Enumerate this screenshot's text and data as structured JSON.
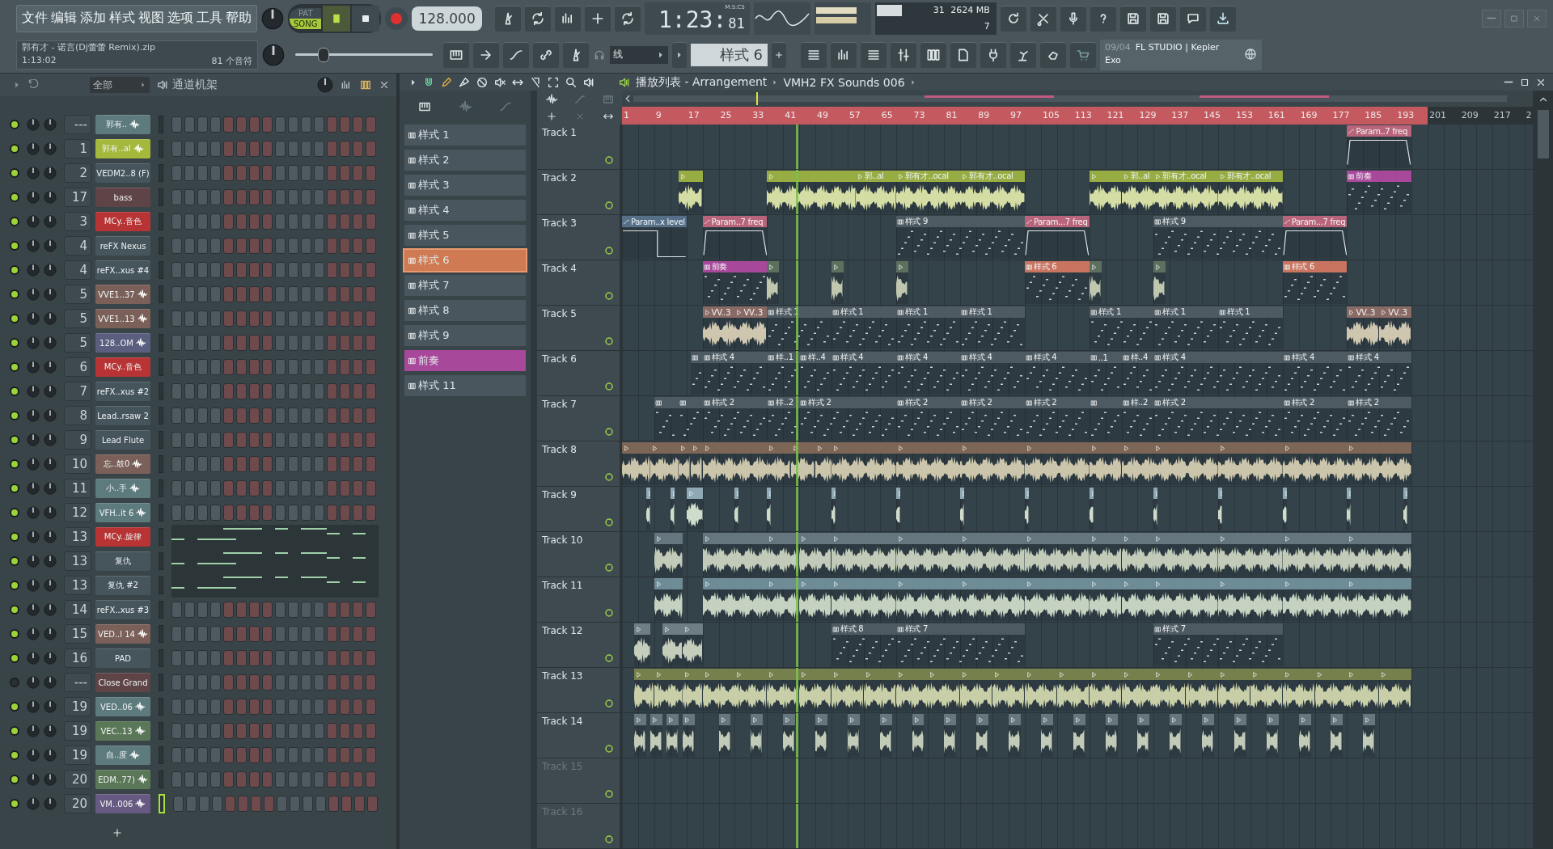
{
  "menu": [
    "文件",
    "编辑",
    "添加",
    "样式",
    "视图",
    "选项",
    "工具",
    "帮助"
  ],
  "song": {
    "title": "郭有才 - 诺言(Dj蕾蕾 Remix).zip",
    "time": "1:13:02",
    "notes": "81 个音符"
  },
  "transport": {
    "modes": [
      {
        "label": "PAT",
        "selected": false
      },
      {
        "label": "SONG",
        "selected": true
      }
    ],
    "tempo": "128.000"
  },
  "time_display": {
    "unit": "M:S:CS",
    "value": "1:23:",
    "centiseconds": "81"
  },
  "cpu": {
    "level": 0.35,
    "voices": "31",
    "memory": "2624 MB",
    "polyphony": "7"
  },
  "master_volume": {
    "level": 0.2
  },
  "snap": {
    "value": "线"
  },
  "pattern_selector": {
    "value": "样式 6"
  },
  "hint": {
    "date": "09/04",
    "title": "FL STUDIO | Kepler",
    "subtitle": "Exo"
  },
  "channel_rack": {
    "filter": "全部",
    "title": "通道机架",
    "channels": [
      {
        "number": "---",
        "name": "郭有..",
        "kind": "sample",
        "color": "#5d7a7c",
        "on": true,
        "selected": false
      },
      {
        "number": "1",
        "name": "郭有..al",
        "kind": "sample",
        "color": "#a4b83c",
        "on": true,
        "selected": false
      },
      {
        "number": "2",
        "name": "VEDM2..8 (F)",
        "kind": "plugin",
        "color": "#46555c",
        "on": true,
        "selected": false
      },
      {
        "number": "17",
        "name": "bass",
        "kind": "plugin",
        "color": "#5e4446",
        "on": true,
        "selected": false
      },
      {
        "number": "3",
        "name": "MCy..音色",
        "kind": "plugin",
        "color": "#b83434",
        "on": true,
        "selected": false
      },
      {
        "number": "4",
        "name": "reFX Nexus",
        "kind": "plugin",
        "color": "#46555c",
        "on": true,
        "selected": false
      },
      {
        "number": "4",
        "name": "reFX..xus #4",
        "kind": "plugin",
        "color": "#46555c",
        "on": true,
        "selected": false
      },
      {
        "number": "5",
        "name": "VVE1..37",
        "kind": "sample",
        "color": "#7a6058",
        "on": true,
        "selected": false
      },
      {
        "number": "5",
        "name": "VVE1..13",
        "kind": "sample",
        "color": "#7a6058",
        "on": true,
        "selected": false
      },
      {
        "number": "5",
        "name": "128..OM",
        "kind": "sample",
        "color": "#5a5f80",
        "on": true,
        "selected": false
      },
      {
        "number": "6",
        "name": "MCy..音色",
        "kind": "plugin",
        "color": "#b83434",
        "on": true,
        "selected": false
      },
      {
        "number": "7",
        "name": "reFX..xus #2",
        "kind": "plugin",
        "color": "#46555c",
        "on": true,
        "selected": false
      },
      {
        "number": "8",
        "name": "Lead..rsaw 2",
        "kind": "plugin",
        "color": "#46555c",
        "on": true,
        "selected": false
      },
      {
        "number": "9",
        "name": "Lead Flute",
        "kind": "plugin",
        "color": "#46555c",
        "on": true,
        "selected": false
      },
      {
        "number": "10",
        "name": "忘..鼓0",
        "kind": "sample",
        "color": "#7a6058",
        "on": true,
        "selected": false
      },
      {
        "number": "11",
        "name": "小..手",
        "kind": "sample",
        "color": "#5d7a7c",
        "on": true,
        "selected": false
      },
      {
        "number": "12",
        "name": "VFH..it 6",
        "kind": "sample",
        "color": "#5d7a7c",
        "on": true,
        "selected": false
      },
      {
        "number": "13",
        "name": "MCy..旋律",
        "kind": "plugin",
        "color": "#b83434",
        "on": true,
        "selected": false,
        "piano_roll": true
      },
      {
        "number": "13",
        "name": "复仇",
        "kind": "plugin",
        "color": "#46555c",
        "on": true,
        "selected": false,
        "piano_roll": true
      },
      {
        "number": "13",
        "name": "复仇 #2",
        "kind": "plugin",
        "color": "#46555c",
        "on": true,
        "selected": false,
        "piano_roll": true
      },
      {
        "number": "14",
        "name": "reFX..xus #3",
        "kind": "plugin",
        "color": "#46555c",
        "on": true,
        "selected": false
      },
      {
        "number": "15",
        "name": "VED..l 14",
        "kind": "sample",
        "color": "#7a6058",
        "on": true,
        "selected": false
      },
      {
        "number": "16",
        "name": "PAD",
        "kind": "plugin",
        "color": "#46555c",
        "on": true,
        "selected": false
      },
      {
        "number": "---",
        "name": "Close Grand",
        "kind": "plugin",
        "color": "#5e4446",
        "on": false,
        "selected": false
      },
      {
        "number": "19",
        "name": "VED..06",
        "kind": "sample",
        "color": "#5d7a7c",
        "on": true,
        "selected": false
      },
      {
        "number": "19",
        "name": "VEC..13",
        "kind": "sample",
        "color": "#5a7858",
        "on": true,
        "selected": false
      },
      {
        "number": "19",
        "name": "自..度",
        "kind": "sample",
        "color": "#5d7a7c",
        "on": true,
        "selected": false
      },
      {
        "number": "20",
        "name": "EDM..77)",
        "kind": "sample",
        "color": "#5a7858",
        "on": true,
        "selected": false
      },
      {
        "number": "20",
        "name": "VM..006",
        "kind": "sample",
        "color": "#675a82",
        "on": true,
        "selected": true
      }
    ]
  },
  "patterns": [
    {
      "name": "样式 1",
      "color": "#4a565d",
      "selected": false
    },
    {
      "name": "样式 2",
      "color": "#4a565d",
      "selected": false
    },
    {
      "name": "样式 3",
      "color": "#4a565d",
      "selected": false
    },
    {
      "name": "样式 4",
      "color": "#4a565d",
      "selected": false
    },
    {
      "name": "样式 5",
      "color": "#4a565d",
      "selected": false
    },
    {
      "name": "样式 6",
      "color": "#cf7a52",
      "selected": true
    },
    {
      "name": "样式 7",
      "color": "#4a565d",
      "selected": false
    },
    {
      "name": "样式 8",
      "color": "#4a565d",
      "selected": false
    },
    {
      "name": "样式 9",
      "color": "#4a565d",
      "selected": false
    },
    {
      "name": "前奏",
      "color": "#a8489a",
      "selected": false
    },
    {
      "name": "样式 11",
      "color": "#4a565d",
      "selected": false
    }
  ],
  "playlist": {
    "title": "播放列表 - Arrangement",
    "current": "VMH2 FX Sounds 006",
    "playhead": {
      "level": 0.191
    },
    "ruler": [
      {
        "label": "1",
        "in_song": true
      },
      {
        "label": "9",
        "in_song": true
      },
      {
        "label": "17",
        "in_song": true
      },
      {
        "label": "25",
        "in_song": true
      },
      {
        "label": "33",
        "in_song": true
      },
      {
        "label": "41",
        "in_song": true
      },
      {
        "label": "49",
        "in_song": true
      },
      {
        "label": "57",
        "in_song": true
      },
      {
        "label": "65",
        "in_song": true
      },
      {
        "label": "73",
        "in_song": true
      },
      {
        "label": "81",
        "in_song": true
      },
      {
        "label": "89",
        "in_song": true
      },
      {
        "label": "97",
        "in_song": true
      },
      {
        "label": "105",
        "in_song": true
      },
      {
        "label": "113",
        "in_song": true
      },
      {
        "label": "121",
        "in_song": true
      },
      {
        "label": "129",
        "in_song": true
      },
      {
        "label": "137",
        "in_song": true
      },
      {
        "label": "145",
        "in_song": true
      },
      {
        "label": "153",
        "in_song": true
      },
      {
        "label": "161",
        "in_song": true
      },
      {
        "label": "169",
        "in_song": true
      },
      {
        "label": "177",
        "in_song": true
      },
      {
        "label": "185",
        "in_song": true
      },
      {
        "label": "193",
        "in_song": true
      },
      {
        "label": "201",
        "in_song": false
      },
      {
        "label": "209",
        "in_song": false
      },
      {
        "label": "217",
        "in_song": false
      },
      {
        "label": "2",
        "in_song": false
      }
    ],
    "tracks": [
      {
        "name": "Track 1",
        "dimmed": false,
        "clips": [
          {
            "kind": "automation",
            "label": "Param..7 freq",
            "color": "#b8647a"
          }
        ]
      },
      {
        "name": "Track 2",
        "dimmed": false,
        "clips": [
          {
            "kind": "audio",
            "color": "#98ac44"
          },
          {
            "kind": "audio",
            "color": "#98ac44"
          },
          {
            "kind": "audio",
            "label": "郭..al",
            "color": "#98ac44"
          },
          {
            "kind": "audio",
            "label": "郭有才..ocal",
            "color": "#98ac44"
          },
          {
            "kind": "audio",
            "label": "郭有才..ocal",
            "color": "#98ac44"
          },
          {
            "kind": "audio",
            "color": "#98ac44"
          },
          {
            "kind": "audio",
            "label": "郭..al",
            "color": "#98ac44"
          },
          {
            "kind": "audio",
            "label": "郭有才..ocal",
            "color": "#98ac44"
          },
          {
            "kind": "audio",
            "label": "郭有才..ocal",
            "color": "#98ac44"
          },
          {
            "kind": "pattern",
            "label": "前奏",
            "color": "#a8489a"
          }
        ]
      },
      {
        "name": "Track 3",
        "dimmed": false,
        "clips": [
          {
            "kind": "automation",
            "label": "Param..x level",
            "color": "#56708a"
          },
          {
            "kind": "automation",
            "label": "Param..7 freq",
            "color": "#b8647a"
          },
          {
            "kind": "pattern",
            "label": "样式 9",
            "color": "#4e5a61"
          },
          {
            "kind": "automation",
            "label": "Param...7 freq",
            "color": "#b8647a"
          },
          {
            "kind": "pattern",
            "label": "样式 9",
            "color": "#4e5a61"
          },
          {
            "kind": "automation",
            "label": "Param...7 freq",
            "color": "#b8647a"
          }
        ]
      },
      {
        "name": "Track 4",
        "dimmed": false,
        "clips": [
          {
            "kind": "pattern",
            "label": "前奏",
            "color": "#a8489a"
          },
          {
            "kind": "audio",
            "color": "#5d7060"
          },
          {
            "kind": "audio",
            "color": "#5d7060"
          },
          {
            "kind": "audio",
            "color": "#5d7060"
          },
          {
            "kind": "pattern",
            "label": "样式 6",
            "color": "#c87460"
          },
          {
            "kind": "audio",
            "color": "#5d7060"
          },
          {
            "kind": "audio",
            "color": "#5d7060"
          },
          {
            "kind": "pattern",
            "label": "样式 6",
            "color": "#c87460"
          }
        ]
      },
      {
        "name": "Track 5",
        "dimmed": false,
        "clips": [
          {
            "kind": "audio",
            "label": "VV..3",
            "color": "#8a6a64"
          },
          {
            "kind": "audio",
            "label": "VV..3",
            "color": "#8a6a64"
          },
          {
            "kind": "pattern",
            "label": "样式 1",
            "color": "#4e5a61"
          },
          {
            "kind": "pattern",
            "label": "样式 1",
            "color": "#4e5a61"
          },
          {
            "kind": "pattern",
            "label": "样式 1",
            "color": "#4e5a61"
          },
          {
            "kind": "pattern",
            "label": "样式 1",
            "color": "#4e5a61"
          },
          {
            "kind": "pattern",
            "label": "样式 1",
            "color": "#4e5a61"
          },
          {
            "kind": "pattern",
            "label": "样式 1",
            "color": "#4e5a61"
          },
          {
            "kind": "pattern",
            "label": "样式 1",
            "color": "#4e5a61"
          },
          {
            "kind": "audio",
            "label": "VV..3",
            "color": "#8a6a64"
          },
          {
            "kind": "audio",
            "label": "VV..3",
            "color": "#8a6a64"
          }
        ]
      },
      {
        "name": "Track 6",
        "dimmed": false,
        "clips": [
          {
            "kind": "pattern",
            "color": "#4e5a61"
          },
          {
            "kind": "pattern",
            "label": "样式 4",
            "color": "#4e5a61"
          },
          {
            "kind": "pattern",
            "label": "样..1",
            "color": "#4e5a61"
          },
          {
            "kind": "pattern",
            "label": "样..4",
            "color": "#4e5a61"
          },
          {
            "kind": "pattern",
            "label": "样式 4",
            "color": "#4e5a61"
          },
          {
            "kind": "pattern",
            "label": "样式 4",
            "color": "#4e5a61"
          },
          {
            "kind": "pattern",
            "label": "样式 4",
            "color": "#4e5a61"
          },
          {
            "kind": "pattern",
            "label": "样式 4",
            "color": "#4e5a61"
          },
          {
            "kind": "pattern",
            "label": "..1",
            "color": "#4e5a61"
          },
          {
            "kind": "pattern",
            "label": "样..4",
            "color": "#4e5a61"
          },
          {
            "kind": "pattern",
            "label": "样式 4",
            "color": "#4e5a61"
          },
          {
            "kind": "pattern",
            "label": "样式 4",
            "color": "#4e5a61"
          },
          {
            "kind": "pattern",
            "label": "样式 4",
            "color": "#4e5a61"
          }
        ]
      },
      {
        "name": "Track 7",
        "dimmed": false,
        "clips": [
          {
            "kind": "pattern",
            "color": "#4e5a61"
          },
          {
            "kind": "pattern",
            "color": "#4e5a61"
          },
          {
            "kind": "pattern",
            "label": "样式 2",
            "color": "#4e5a61"
          },
          {
            "kind": "pattern",
            "label": "样..2",
            "color": "#4e5a61"
          },
          {
            "kind": "pattern",
            "label": "样式 2",
            "color": "#4e5a61"
          },
          {
            "kind": "pattern",
            "label": "样式 2",
            "color": "#4e5a61"
          },
          {
            "kind": "pattern",
            "label": "样式 2",
            "color": "#4e5a61"
          },
          {
            "kind": "pattern",
            "label": "样式 2",
            "color": "#4e5a61"
          },
          {
            "kind": "pattern",
            "color": "#4e5a61"
          },
          {
            "kind": "pattern",
            "label": "样..2",
            "color": "#4e5a61"
          },
          {
            "kind": "pattern",
            "label": "样式 2",
            "color": "#4e5a61"
          },
          {
            "kind": "pattern",
            "label": "样式 2",
            "color": "#4e5a61"
          },
          {
            "kind": "pattern",
            "label": "样式 2",
            "color": "#4e5a61"
          }
        ]
      },
      {
        "name": "Track 8",
        "dimmed": false,
        "clips": [
          {
            "kind": "audio",
            "color": "#7e6656"
          },
          {
            "kind": "audio",
            "color": "#7e6656"
          },
          {
            "kind": "audio",
            "color": "#7e6656"
          },
          {
            "kind": "audio",
            "color": "#7e6656"
          },
          {
            "kind": "audio",
            "color": "#7e6656"
          },
          {
            "kind": "audio",
            "color": "#7e6656"
          },
          {
            "kind": "audio",
            "color": "#7e6656"
          },
          {
            "kind": "audio",
            "color": "#7e6656"
          },
          {
            "kind": "audio",
            "color": "#7e6656"
          },
          {
            "kind": "audio",
            "color": "#7e6656"
          },
          {
            "kind": "audio",
            "color": "#7e6656"
          },
          {
            "kind": "audio",
            "color": "#7e6656"
          },
          {
            "kind": "audio",
            "color": "#7e6656"
          },
          {
            "kind": "audio",
            "color": "#7e6656"
          },
          {
            "kind": "audio",
            "color": "#7e6656"
          },
          {
            "kind": "audio",
            "color": "#7e6656"
          },
          {
            "kind": "audio",
            "color": "#7e6656"
          },
          {
            "kind": "audio",
            "color": "#7e6656"
          }
        ]
      },
      {
        "name": "Track 9",
        "dimmed": false,
        "clips": [
          {
            "kind": "audio",
            "color": "#8ea8b4"
          },
          {
            "kind": "audio",
            "color": "#8ea8b4"
          },
          {
            "kind": "audio",
            "color": "#8ea8b4"
          },
          {
            "kind": "audio",
            "color": "#8ea8b4"
          },
          {
            "kind": "audio",
            "color": "#8ea8b4"
          },
          {
            "kind": "audio",
            "color": "#8ea8b4"
          },
          {
            "kind": "audio",
            "color": "#8ea8b4"
          },
          {
            "kind": "audio",
            "color": "#8ea8b4"
          },
          {
            "kind": "audio",
            "color": "#8ea8b4"
          },
          {
            "kind": "audio",
            "color": "#8ea8b4"
          },
          {
            "kind": "audio",
            "color": "#8ea8b4"
          },
          {
            "kind": "audio",
            "color": "#8ea8b4"
          },
          {
            "kind": "audio",
            "color": "#8ea8b4"
          },
          {
            "kind": "audio",
            "color": "#8ea8b4"
          },
          {
            "kind": "audio",
            "color": "#8ea8b4"
          }
        ]
      },
      {
        "name": "Track 10",
        "dimmed": false,
        "clips": [
          {
            "kind": "audio",
            "color": "#66767e"
          },
          {
            "kind": "audio",
            "color": "#66767e"
          },
          {
            "kind": "audio",
            "color": "#66767e"
          },
          {
            "kind": "audio",
            "color": "#66767e"
          },
          {
            "kind": "audio",
            "color": "#66767e"
          },
          {
            "kind": "audio",
            "color": "#66767e"
          },
          {
            "kind": "audio",
            "color": "#66767e"
          },
          {
            "kind": "audio",
            "color": "#66767e"
          },
          {
            "kind": "audio",
            "color": "#66767e"
          },
          {
            "kind": "audio",
            "color": "#66767e"
          },
          {
            "kind": "audio",
            "color": "#66767e"
          },
          {
            "kind": "audio",
            "color": "#66767e"
          },
          {
            "kind": "audio",
            "color": "#66767e"
          },
          {
            "kind": "audio",
            "color": "#66767e"
          }
        ]
      },
      {
        "name": "Track 11",
        "dimmed": false,
        "clips": [
          {
            "kind": "audio",
            "color": "#6e8c96"
          },
          {
            "kind": "audio",
            "color": "#6e8c96"
          },
          {
            "kind": "audio",
            "color": "#6e8c96"
          },
          {
            "kind": "audio",
            "color": "#6e8c96"
          },
          {
            "kind": "audio",
            "color": "#6e8c96"
          },
          {
            "kind": "audio",
            "color": "#6e8c96"
          },
          {
            "kind": "audio",
            "color": "#6e8c96"
          },
          {
            "kind": "audio",
            "color": "#6e8c96"
          },
          {
            "kind": "audio",
            "color": "#6e8c96"
          },
          {
            "kind": "audio",
            "color": "#6e8c96"
          },
          {
            "kind": "audio",
            "color": "#6e8c96"
          },
          {
            "kind": "audio",
            "color": "#6e8c96"
          },
          {
            "kind": "audio",
            "color": "#6e8c96"
          },
          {
            "kind": "audio",
            "color": "#6e8c96"
          }
        ]
      },
      {
        "name": "Track 12",
        "dimmed": false,
        "clips": [
          {
            "kind": "audio",
            "color": "#6e7e84"
          },
          {
            "kind": "audio",
            "color": "#6e7e84"
          },
          {
            "kind": "audio",
            "color": "#6e7e84"
          },
          {
            "kind": "pattern",
            "label": "样式 8",
            "color": "#4e5a61"
          },
          {
            "kind": "pattern",
            "label": "样式 7",
            "color": "#4e5a61"
          },
          {
            "kind": "pattern",
            "label": "样式 7",
            "color": "#4e5a61"
          }
        ]
      },
      {
        "name": "Track 13",
        "dimmed": false,
        "clips": [
          {
            "kind": "audio",
            "color": "#76804c"
          },
          {
            "kind": "audio",
            "color": "#76804c"
          },
          {
            "kind": "audio",
            "color": "#76804c"
          },
          {
            "kind": "audio",
            "color": "#76804c"
          },
          {
            "kind": "audio",
            "color": "#76804c"
          },
          {
            "kind": "audio",
            "color": "#76804c"
          },
          {
            "kind": "audio",
            "color": "#76804c"
          },
          {
            "kind": "audio",
            "color": "#76804c"
          },
          {
            "kind": "audio",
            "color": "#76804c"
          },
          {
            "kind": "audio",
            "color": "#76804c"
          },
          {
            "kind": "audio",
            "color": "#76804c"
          },
          {
            "kind": "audio",
            "color": "#76804c"
          },
          {
            "kind": "audio",
            "color": "#76804c"
          },
          {
            "kind": "audio",
            "color": "#76804c"
          },
          {
            "kind": "audio",
            "color": "#76804c"
          },
          {
            "kind": "audio",
            "color": "#76804c"
          },
          {
            "kind": "audio",
            "color": "#76804c"
          },
          {
            "kind": "audio",
            "color": "#76804c"
          },
          {
            "kind": "audio",
            "color": "#76804c"
          },
          {
            "kind": "audio",
            "color": "#76804c"
          },
          {
            "kind": "audio",
            "color": "#76804c"
          },
          {
            "kind": "audio",
            "color": "#76804c"
          },
          {
            "kind": "audio",
            "color": "#76804c"
          },
          {
            "kind": "audio",
            "color": "#76804c"
          },
          {
            "kind": "audio",
            "color": "#76804c"
          }
        ]
      },
      {
        "name": "Track 14",
        "dimmed": false,
        "clips": [
          {
            "kind": "audio",
            "color": "#66767c"
          },
          {
            "kind": "audio",
            "color": "#66767c"
          },
          {
            "kind": "audio",
            "color": "#66767c"
          },
          {
            "kind": "audio",
            "color": "#66767c"
          },
          {
            "kind": "audio",
            "color": "#66767c"
          },
          {
            "kind": "audio",
            "color": "#66767c"
          },
          {
            "kind": "audio",
            "color": "#66767c"
          },
          {
            "kind": "audio",
            "color": "#66767c"
          },
          {
            "kind": "audio",
            "color": "#66767c"
          },
          {
            "kind": "audio",
            "color": "#66767c"
          },
          {
            "kind": "audio",
            "color": "#66767c"
          },
          {
            "kind": "audio",
            "color": "#66767c"
          },
          {
            "kind": "audio",
            "color": "#66767c"
          },
          {
            "kind": "audio",
            "color": "#66767c"
          },
          {
            "kind": "audio",
            "color": "#66767c"
          },
          {
            "kind": "audio",
            "color": "#66767c"
          },
          {
            "kind": "audio",
            "color": "#66767c"
          },
          {
            "kind": "audio",
            "color": "#66767c"
          },
          {
            "kind": "audio",
            "color": "#66767c"
          },
          {
            "kind": "audio",
            "color": "#66767c"
          },
          {
            "kind": "audio",
            "color": "#66767c"
          },
          {
            "kind": "audio",
            "color": "#66767c"
          },
          {
            "kind": "audio",
            "color": "#66767c"
          },
          {
            "kind": "audio",
            "color": "#66767c"
          },
          {
            "kind": "audio",
            "color": "#66767c"
          }
        ]
      },
      {
        "name": "Track 15",
        "dimmed": true
      },
      {
        "name": "Track 16",
        "dimmed": true
      }
    ]
  }
}
